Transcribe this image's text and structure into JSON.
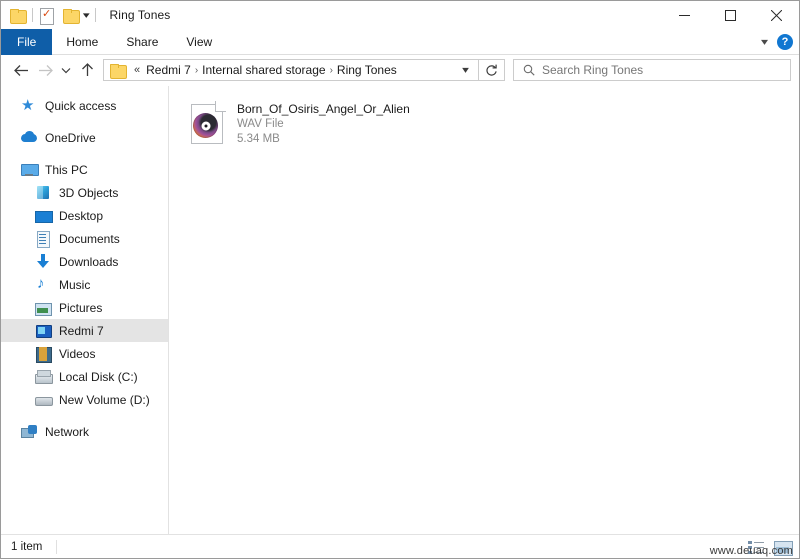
{
  "window": {
    "title": "Ring Tones",
    "controls": {
      "minimize": "minimize-icon",
      "maximize": "maximize-icon",
      "close": "close-icon"
    },
    "quick_access_toolbar": [
      {
        "name": "folder-icon",
        "label": ""
      },
      {
        "name": "properties-icon",
        "label": ""
      },
      {
        "name": "new-folder-icon",
        "label": ""
      },
      {
        "name": "chevron-down-icon",
        "label": ""
      }
    ]
  },
  "ribbon": {
    "tabs": [
      {
        "label": "File",
        "active": true
      },
      {
        "label": "Home",
        "active": false
      },
      {
        "label": "Share",
        "active": false
      },
      {
        "label": "View",
        "active": false
      }
    ],
    "collapse_icon": "chevron-down-icon",
    "help_icon": "help-icon",
    "help_glyph": "?"
  },
  "navigation": {
    "back": "back-arrow-icon",
    "forward": "forward-arrow-icon",
    "recent": "chevron-down-icon",
    "up": "up-arrow-icon",
    "refresh": "refresh-icon",
    "address_folder_icon": "folder-icon",
    "breadcrumb_prefix": "«",
    "breadcrumbs": [
      "Redmi 7",
      "Internal shared storage",
      "Ring Tones"
    ],
    "breadcrumb_separator": "›",
    "address_dropdown": "chevron-down-icon"
  },
  "search": {
    "icon": "search-icon",
    "placeholder": "Search Ring Tones",
    "value": ""
  },
  "sidebar": {
    "items": [
      {
        "label": "Quick access",
        "icon": "star-icon",
        "indent": 0,
        "selected": false,
        "gap_after": true
      },
      {
        "label": "OneDrive",
        "icon": "cloud-icon",
        "indent": 0,
        "selected": false,
        "gap_after": true
      },
      {
        "label": "This PC",
        "icon": "monitor-icon",
        "indent": 0,
        "selected": false,
        "gap_after": false
      },
      {
        "label": "3D Objects",
        "icon": "cube-icon",
        "indent": 1,
        "selected": false,
        "gap_after": false
      },
      {
        "label": "Desktop",
        "icon": "desktop-icon",
        "indent": 1,
        "selected": false,
        "gap_after": false
      },
      {
        "label": "Documents",
        "icon": "document-icon",
        "indent": 1,
        "selected": false,
        "gap_after": false
      },
      {
        "label": "Downloads",
        "icon": "download-arrow-icon",
        "indent": 1,
        "selected": false,
        "gap_after": false
      },
      {
        "label": "Music",
        "icon": "music-note-icon",
        "indent": 1,
        "selected": false,
        "gap_after": false
      },
      {
        "label": "Pictures",
        "icon": "picture-icon",
        "indent": 1,
        "selected": false,
        "gap_after": false
      },
      {
        "label": "Redmi 7",
        "icon": "phone-icon",
        "indent": 1,
        "selected": true,
        "gap_after": false
      },
      {
        "label": "Videos",
        "icon": "video-icon",
        "indent": 1,
        "selected": false,
        "gap_after": false
      },
      {
        "label": "Local Disk (C:)",
        "icon": "hard-disk-icon",
        "indent": 1,
        "selected": false,
        "gap_after": false
      },
      {
        "label": "New Volume (D:)",
        "icon": "hard-disk-icon",
        "indent": 1,
        "selected": false,
        "gap_after": true
      },
      {
        "label": "Network",
        "icon": "network-icon",
        "indent": 0,
        "selected": false,
        "gap_after": false
      }
    ]
  },
  "content": {
    "files": [
      {
        "name": "Born_Of_Osiris_Angel_Or_Alien",
        "type": "WAV File",
        "size": "5.34 MB",
        "icon": "audio-file-icon"
      }
    ]
  },
  "status": {
    "item_count": "1 item",
    "view_details_icon": "details-view-icon",
    "view_large_icon": "large-icons-view-icon"
  },
  "watermark": {
    "text": "www.deuaq.com"
  }
}
